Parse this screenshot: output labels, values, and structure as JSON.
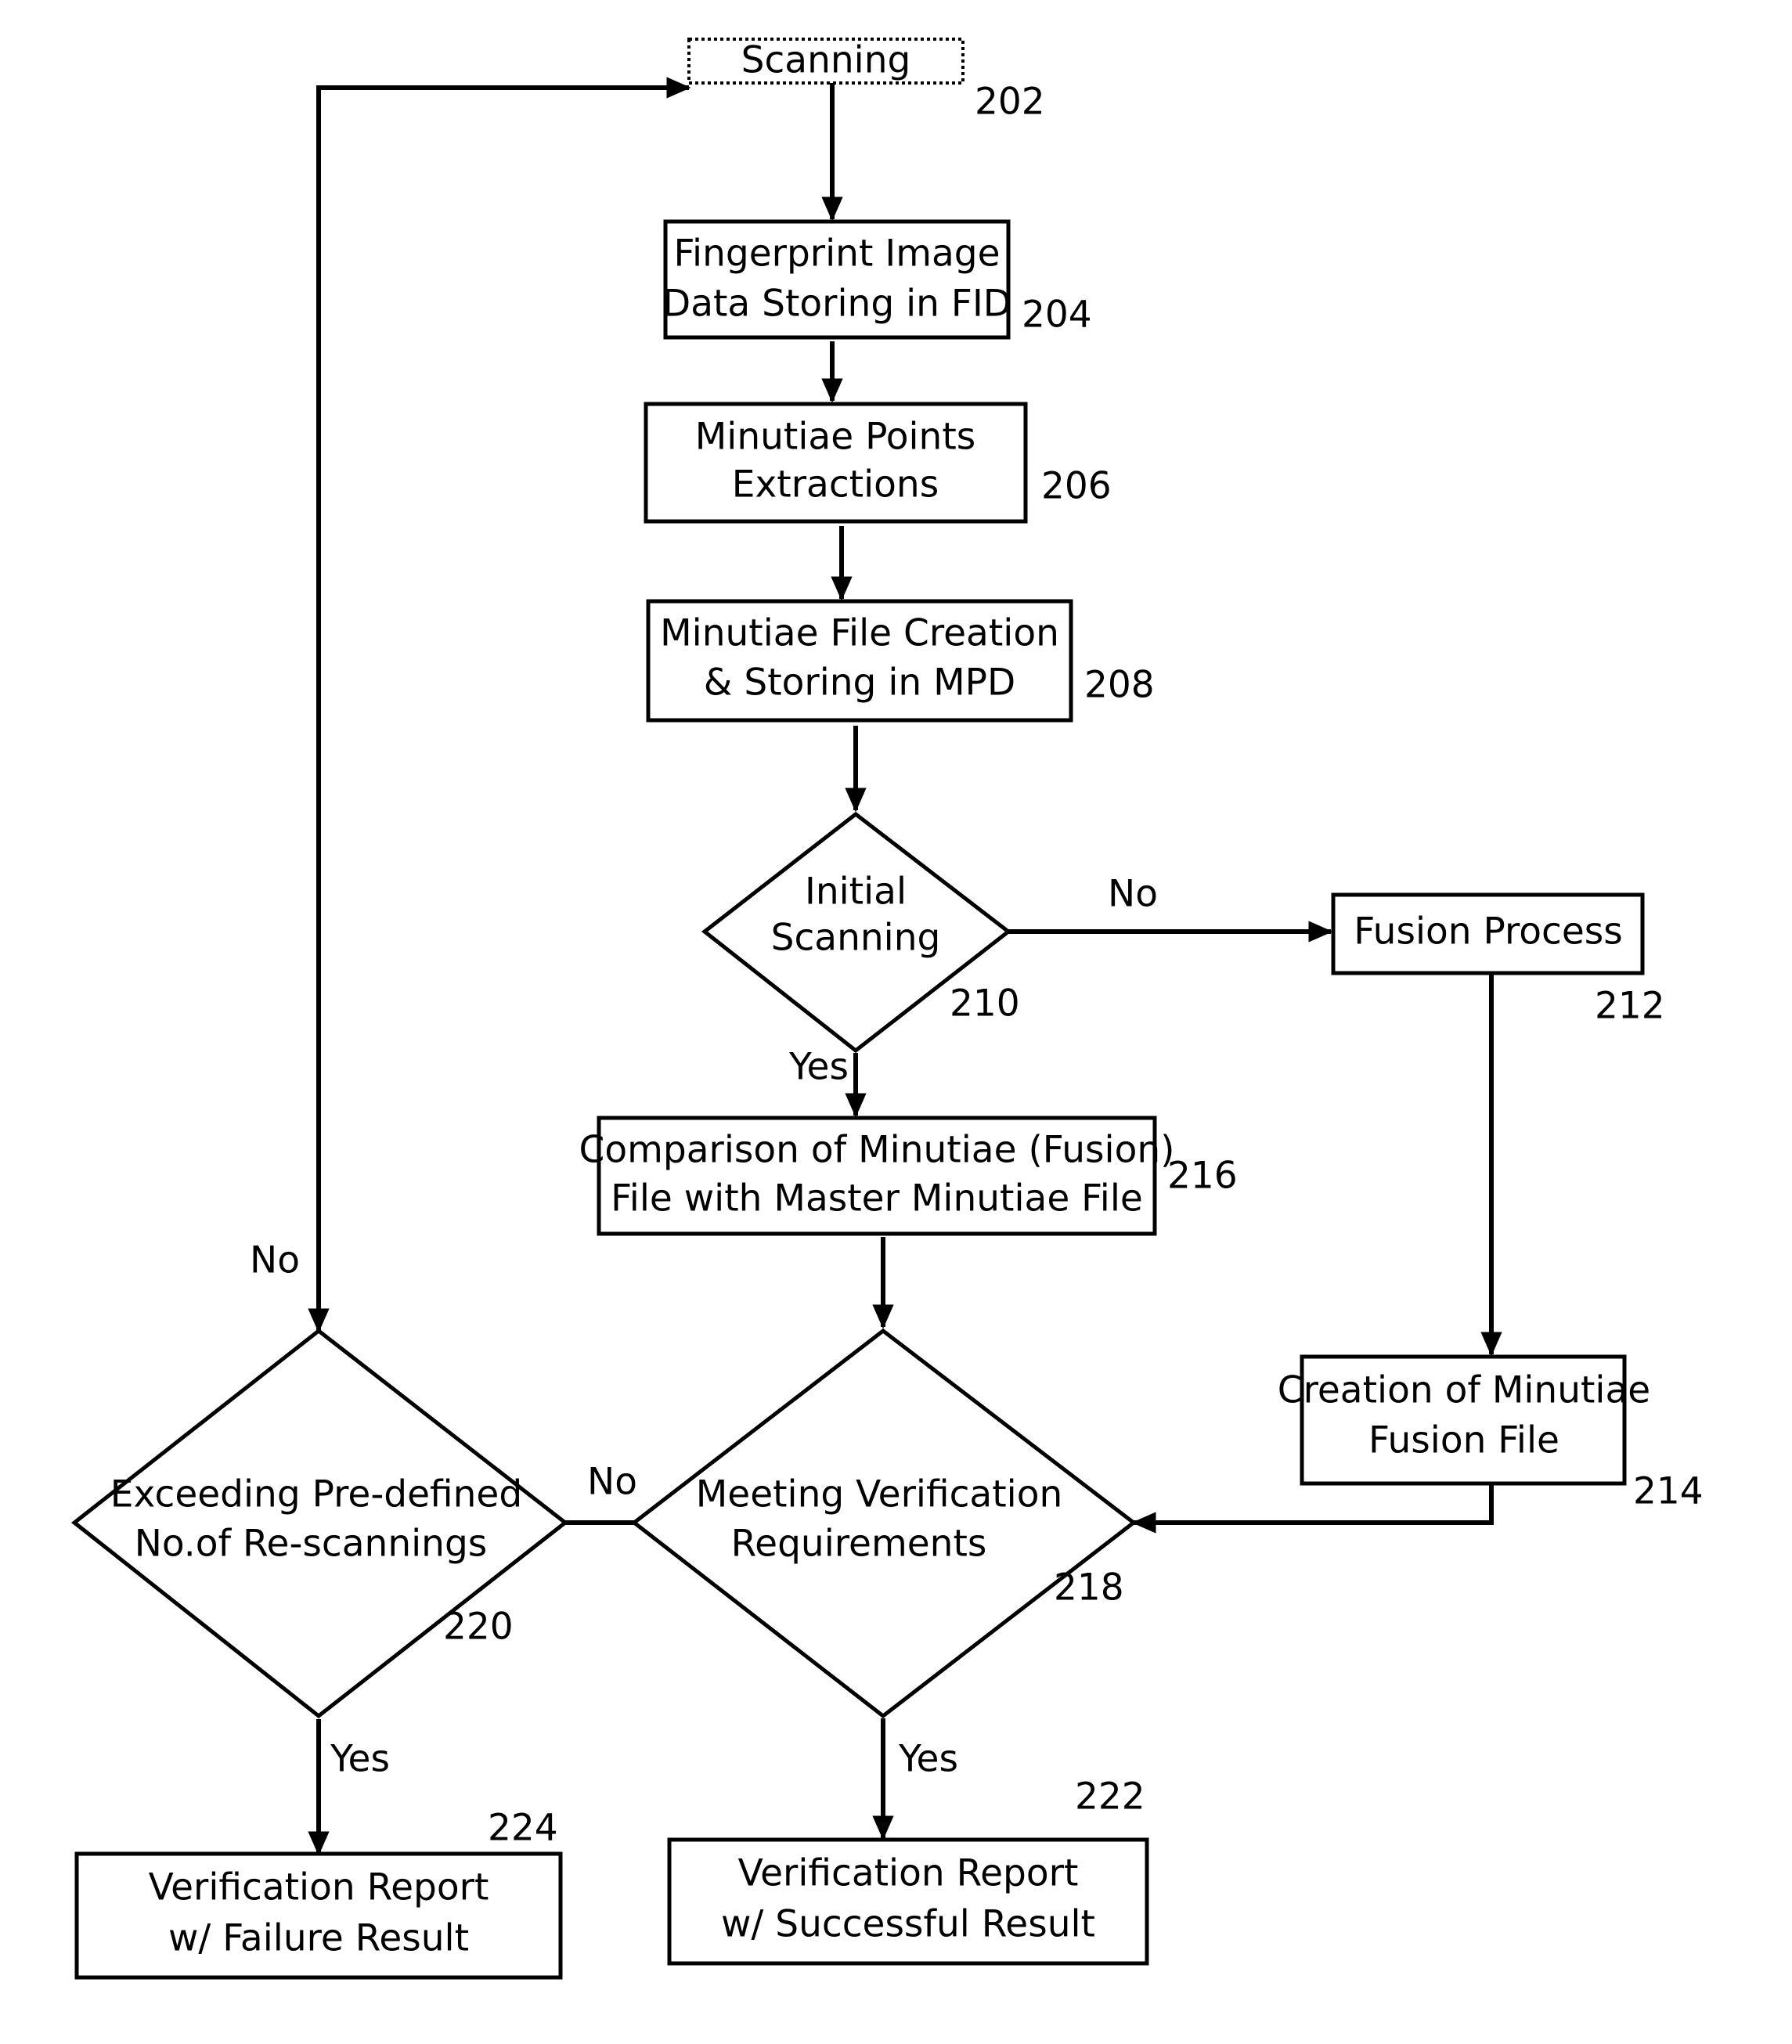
{
  "diagram": {
    "type": "flowchart",
    "title": "Fingerprint Scanning and Verification Process Flowchart",
    "nodes": {
      "scanning": {
        "ref": "202",
        "shape": "process-dashed",
        "lines": [
          "Scanning"
        ]
      },
      "fingerprint_storing": {
        "ref": "204",
        "shape": "process",
        "lines": [
          "Fingerprint Image",
          "Data Storing in FID"
        ]
      },
      "minutiae_extraction": {
        "ref": "206",
        "shape": "process",
        "lines": [
          "Minutiae Points",
          "Extractions"
        ]
      },
      "minutiae_file_creation": {
        "ref": "208",
        "shape": "process",
        "lines": [
          "Minutiae File Creation",
          "& Storing in MPD"
        ]
      },
      "initial_scanning": {
        "ref": "210",
        "shape": "decision",
        "lines": [
          "Initial",
          "Scanning"
        ]
      },
      "fusion_process": {
        "ref": "212",
        "shape": "process",
        "lines": [
          "Fusion Process"
        ]
      },
      "creation_fusion_file": {
        "ref": "214",
        "shape": "process",
        "lines": [
          "Creation of Minutiae",
          "Fusion File"
        ]
      },
      "comparison": {
        "ref": "216",
        "shape": "process",
        "lines": [
          "Comparison of Minutiae (Fusion)",
          "File with Master Minutiae File"
        ]
      },
      "meeting_verification": {
        "ref": "218",
        "shape": "decision",
        "lines": [
          "Meeting Verification",
          "Requirements"
        ]
      },
      "exceeding_rescans": {
        "ref": "220",
        "shape": "decision",
        "lines": [
          "Exceeding Pre-defined",
          "No.of Re-scannings"
        ]
      },
      "report_success": {
        "ref": "222",
        "shape": "process",
        "lines": [
          "Verification Report",
          "w/ Successful Result"
        ]
      },
      "report_failure": {
        "ref": "224",
        "shape": "process",
        "lines": [
          "Verification Report",
          "w/ Failure Result"
        ]
      }
    },
    "edge_labels": {
      "initial_scanning_no": "No",
      "initial_scanning_yes": "Yes",
      "meeting_verification_no": "No",
      "meeting_verification_yes": "Yes",
      "exceeding_rescans_no": "No",
      "exceeding_rescans_yes": "Yes"
    },
    "colors": {
      "stroke": "#000000",
      "fill": "#ffffff",
      "text": "#000000"
    }
  }
}
